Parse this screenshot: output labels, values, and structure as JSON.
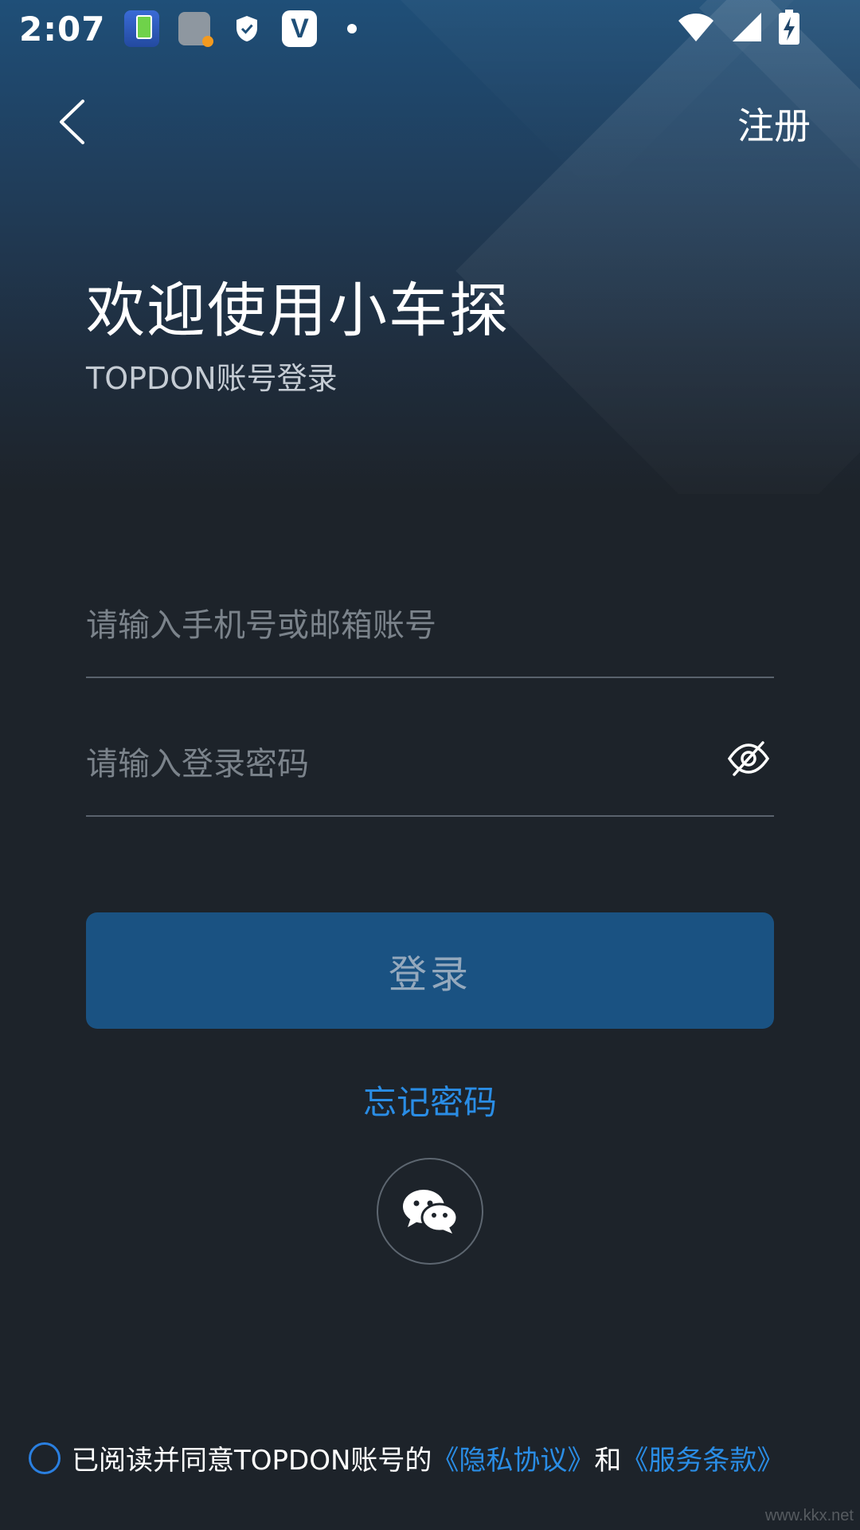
{
  "status_bar": {
    "time": "2:07",
    "icons": [
      "battery-app-icon",
      "battery-alert-icon",
      "shield-icon",
      "v-app-icon",
      "dot-icon",
      "wifi-icon",
      "signal-icon",
      "battery-charging-icon"
    ],
    "v_label": "V"
  },
  "header": {
    "back_icon": "chevron-left-icon",
    "register_label": "注册"
  },
  "hero": {
    "title": "欢迎使用小车探",
    "subtitle": "TOPDON账号登录"
  },
  "form": {
    "account_placeholder": "请输入手机号或邮箱账号",
    "password_placeholder": "请输入登录密码",
    "password_toggle_icon": "eye-off-icon"
  },
  "actions": {
    "login_label": "登录",
    "forgot_label": "忘记密码",
    "wechat_icon": "wechat-icon"
  },
  "agreement": {
    "prefix": "已阅读并同意TOPDON账号的",
    "privacy_link": "《隐私协议》",
    "conjunction": "和",
    "terms_link": "《服务条款》"
  },
  "watermark": "www.kkx.net",
  "colors": {
    "background": "#1d232a",
    "accent": "#2a8de5",
    "login_button": "#1a5282",
    "login_text": "#95a9bd",
    "placeholder": "#7b838b"
  }
}
